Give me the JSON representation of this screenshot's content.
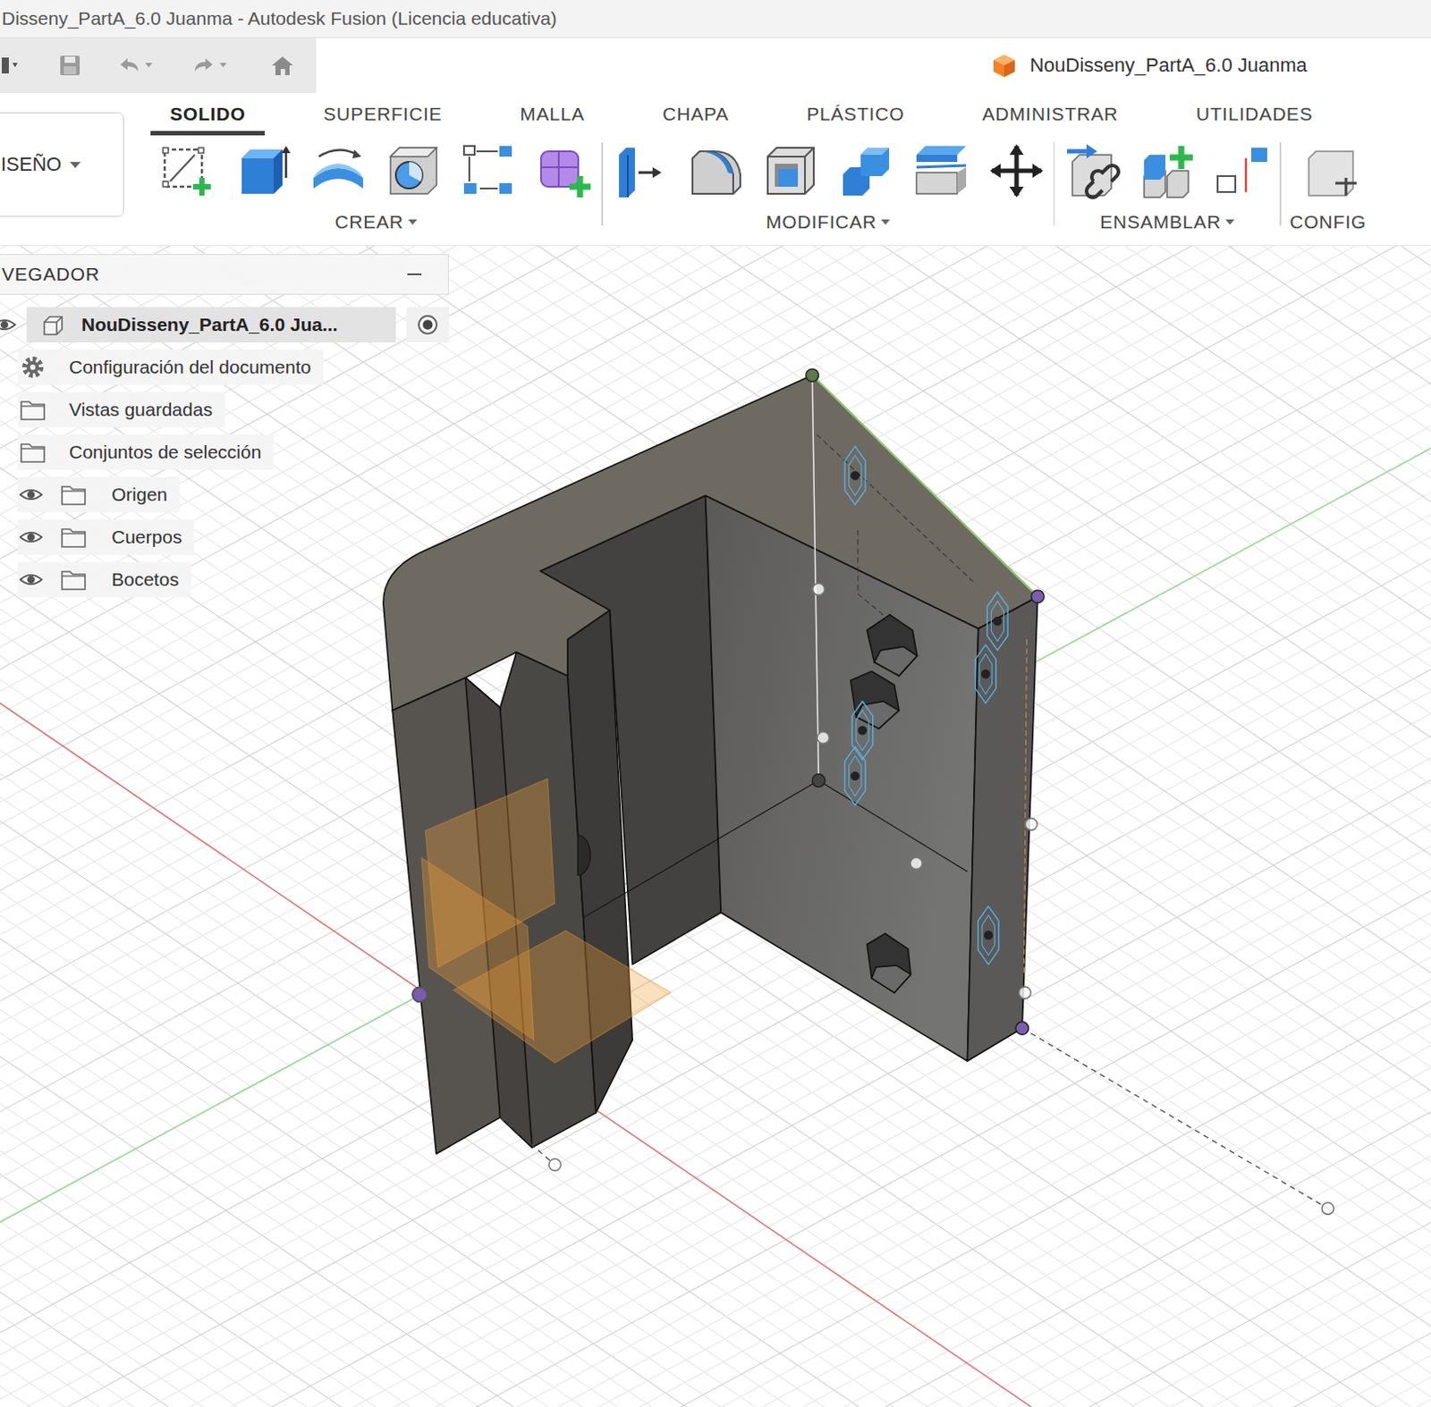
{
  "window": {
    "title": "Disseny_PartA_6.0 Juanma - Autodesk Fusion (Licencia educativa)"
  },
  "document_tab": {
    "label": "NouDisseny_PartA_6.0 Juanma"
  },
  "workspace": {
    "label": "ISEÑO"
  },
  "tabs": [
    {
      "label": "SOLIDO",
      "selected": true
    },
    {
      "label": "SUPERFICIE",
      "selected": false
    },
    {
      "label": "MALLA",
      "selected": false
    },
    {
      "label": "CHAPA",
      "selected": false
    },
    {
      "label": "PLÁSTICO",
      "selected": false
    },
    {
      "label": "ADMINISTRAR",
      "selected": false
    },
    {
      "label": "UTILIDADES",
      "selected": false
    }
  ],
  "tool_groups": [
    {
      "label": "CREAR"
    },
    {
      "label": "MODIFICAR"
    },
    {
      "label": "ENSAMBLAR"
    },
    {
      "label": "CONFIG"
    }
  ],
  "browser": {
    "title": "VEGADOR",
    "items": [
      {
        "label": "NouDisseny_PartA_6.0 Jua...",
        "kind": "root",
        "visibility_toggle": true,
        "active": true
      },
      {
        "label": "Configuración del documento",
        "kind": "settings",
        "visibility_toggle": false,
        "active": false
      },
      {
        "label": "Vistas guardadas",
        "kind": "folder",
        "visibility_toggle": false,
        "active": false
      },
      {
        "label": "Conjuntos de selección",
        "kind": "folder",
        "visibility_toggle": false,
        "active": false
      },
      {
        "label": "Origen",
        "kind": "folder",
        "visibility_toggle": true,
        "active": false
      },
      {
        "label": "Cuerpos",
        "kind": "folder",
        "visibility_toggle": true,
        "active": false
      },
      {
        "label": "Bocetos",
        "kind": "folder",
        "visibility_toggle": true,
        "active": false
      }
    ]
  }
}
